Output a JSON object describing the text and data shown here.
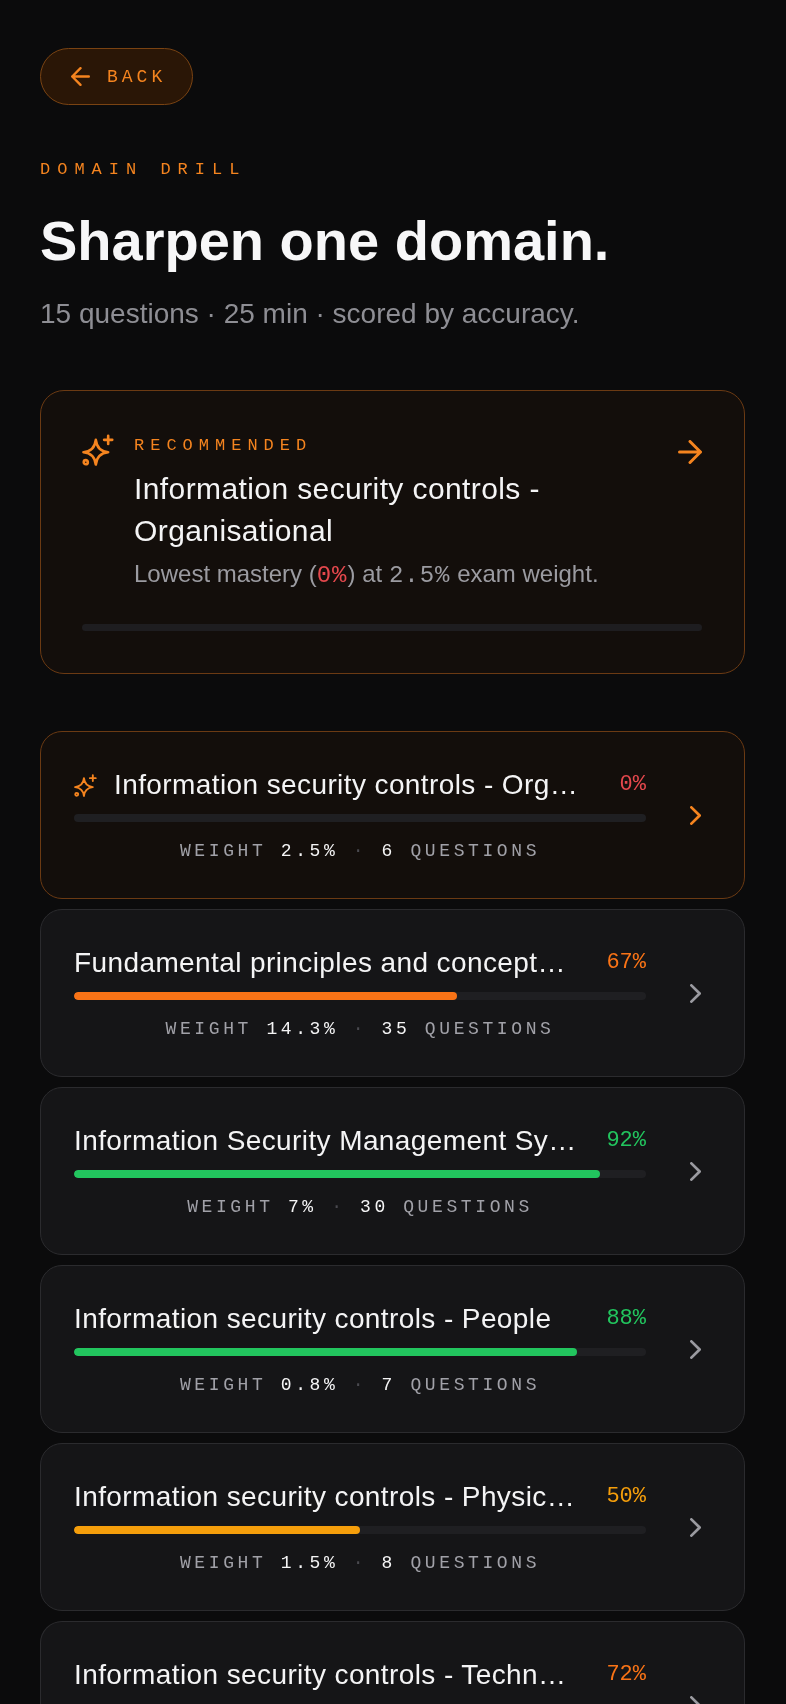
{
  "back_button": {
    "label": "BACK"
  },
  "header": {
    "eyebrow": "DOMAIN DRILL",
    "title": "Sharpen one domain.",
    "subtitle": "15 questions · 25 min · scored by accuracy."
  },
  "recommended": {
    "label": "RECOMMENDED",
    "title": "Information security controls - Organisational",
    "note": [
      {
        "kind": "text",
        "text": "Lowest mastery ("
      },
      {
        "kind": "mastery",
        "text": "0%"
      },
      {
        "kind": "text",
        "text": ") at "
      },
      {
        "kind": "figure",
        "text": "2.5%"
      },
      {
        "kind": "text",
        "text": " exam weight."
      }
    ],
    "level": 0
  },
  "domains": [
    {
      "title": "Information security controls - Org…",
      "recommended": true,
      "mastery": "0%",
      "color": "#e5484d",
      "level": 0,
      "weight_label": "WEIGHT",
      "weight": "2.5%",
      "separator": "·",
      "questions": "6",
      "questions_label": "QUESTIONS"
    },
    {
      "title": "Fundamental principles and concept…",
      "recommended": false,
      "mastery": "67%",
      "color": "#f97316",
      "level": 0.67,
      "weight_label": "WEIGHT",
      "weight": "14.3%",
      "separator": "·",
      "questions": "35",
      "questions_label": "QUESTIONS"
    },
    {
      "title": "Information Security Management Sy…",
      "recommended": false,
      "mastery": "92%",
      "color": "#22c55e",
      "level": 0.92,
      "weight_label": "WEIGHT",
      "weight": "7%",
      "separator": "·",
      "questions": "30",
      "questions_label": "QUESTIONS"
    },
    {
      "title": "Information security controls - People",
      "recommended": false,
      "mastery": "88%",
      "color": "#22c55e",
      "level": 0.88,
      "weight_label": "WEIGHT",
      "weight": "0.8%",
      "separator": "·",
      "questions": "7",
      "questions_label": "QUESTIONS"
    },
    {
      "title": "Information security controls - Physic…",
      "recommended": false,
      "mastery": "50%",
      "color": "#f59e0b",
      "level": 0.5,
      "weight_label": "WEIGHT",
      "weight": "1.5%",
      "separator": "·",
      "questions": "8",
      "questions_label": "QUESTIONS"
    },
    {
      "title": "Information security controls - Techn…",
      "recommended": false,
      "mastery": "72%",
      "color": "#f97316"
    }
  ]
}
